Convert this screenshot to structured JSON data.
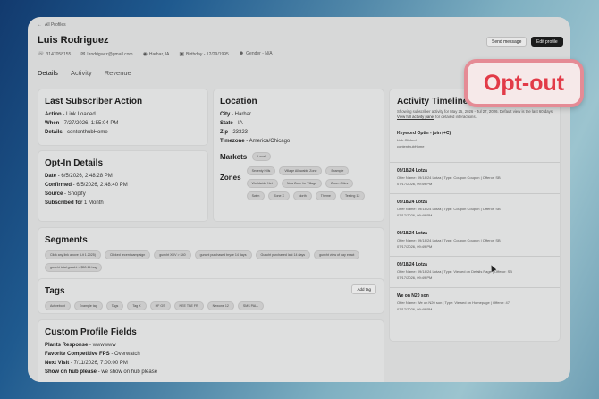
{
  "header": {
    "back_label": "All Profiles",
    "profile_name": "Luis Rodriguez",
    "phone": "3147058155",
    "email": "l.rodriguez@gmail.com",
    "location": "Harhar, IA",
    "birthday": "Birthday - 12/29/1995",
    "gender": "Gender - N/A",
    "send_message_label": "Send message",
    "edit_profile_label": "Edit profile"
  },
  "tabs": [
    {
      "label": "Details",
      "active": true
    },
    {
      "label": "Activity",
      "active": false
    },
    {
      "label": "Revenue",
      "active": false
    }
  ],
  "last_action": {
    "title": "Last Subscriber Action",
    "action_label": "Action",
    "action_value": "- Link Loaded",
    "when_label": "When",
    "when_value": "- 7/27/2026, 1:55:04 PM",
    "details_label": "Details",
    "details_value": "- contenthubHome"
  },
  "optin": {
    "title": "Opt-In Details",
    "date_label": "Date",
    "date_value": "- 6/5/2026, 2:48:28 PM",
    "confirmed_label": "Confirmed",
    "confirmed_value": "- 6/5/2026, 2:48:40 PM",
    "source_label": "Source",
    "source_value": "- Shopify",
    "subscribed_label": "Subscribed for",
    "subscribed_value": "1 Month"
  },
  "location": {
    "title": "Location",
    "city_label": "City",
    "city_value": "- Harhar",
    "state_label": "State",
    "state_value": "- IA",
    "zip_label": "Zip",
    "zip_value": "- 23323",
    "tz_label": "Timezone",
    "tz_value": "- America/Chicago",
    "markets_title": "Markets",
    "markets": [
      "Local"
    ],
    "zones_title": "Zones",
    "zones": [
      "Seventy Hills",
      "Village Allowable Zone",
      "Example",
      "Worldwide Net",
      "New Zone for Village",
      "Zoom Cities",
      "Swim",
      "Zone X",
      "North",
      "Theme",
      "Testing 12"
    ]
  },
  "segments": {
    "title": "Segments",
    "items": [
      "Click any link above (Lit 1.2025)",
      "Clicked recent campaign",
      "guncht XDV > $40",
      "guncht purchased bryce 14 days",
      "Guncht purchased last 14 days",
      "guncht view of day exact",
      "guncht total guncht > $50.14 bag"
    ]
  },
  "tags": {
    "title": "Tags",
    "add_label": "Add tag",
    "items": [
      "Activeboot",
      "Example tag",
      "Tags",
      "Tag X",
      "HF GS",
      "NEE TBE FR",
      "Newone 12",
      "SMS PALL"
    ]
  },
  "custom": {
    "title": "Custom Profile Fields",
    "f1_label": "Plants Response",
    "f1_value": "- wwwwww",
    "f2_label": "Favorite Competitive FPS",
    "f2_value": "- Overwatch",
    "f3_label": "Next Visit",
    "f3_value": "- 7/11/2026, 7:00:00 PM",
    "f4_label": "Show on hub please",
    "f4_value": "- we show on hub please"
  },
  "activity": {
    "title": "Activity Timeline",
    "subtitle_1": "Showing subscriber activity for May 25, 2026 - Jul 27, 2026. Default view is",
    "subtitle_2": "the last 60 days.",
    "link_text": "View full activity panel",
    "subtitle_3": "for detailed interactions.",
    "items": [
      {
        "title": "Keyword Optin - join (+C)",
        "line1": "Link Clicked",
        "line2": "contenthubHome"
      },
      {
        "title": "09/18/24 Lotza",
        "line1": "Offer Name: 09/18/24 Lotza | Type: Coupon Coupon | Offeror: SB",
        "line2": "07/17/2026, 09:49 PM"
      },
      {
        "title": "09/18/24 Lotza",
        "line1": "Offer Name: 09/18/24 Lotza | Type: Coupon Coupon | Offeror: SB",
        "line2": "07/17/2026, 09:49 PM"
      },
      {
        "title": "09/18/24 Lotza",
        "line1": "Offer Name: 09/18/24 Lotza | Type: Coupon Coupon | Offeror: SB",
        "line2": "07/17/2026, 09:49 PM"
      },
      {
        "title": "09/18/24 Lotza",
        "line1": "Offer Name: 09/18/24 Lotza | Type: Viewed on Details Page | Offeror: SB",
        "line2": "07/17/2026, 09:49 PM"
      },
      {
        "title": "We on N20 son",
        "line1": "Offer Name: We on N20 son | Type: Viewed on Homepage | Offeror: 47",
        "line2": "07/17/2026, 09:49 PM"
      }
    ]
  },
  "badge": {
    "label": "Opt-out",
    "bg": "#f6e9e9",
    "border": "#e58b95",
    "text": "#e23b48"
  }
}
